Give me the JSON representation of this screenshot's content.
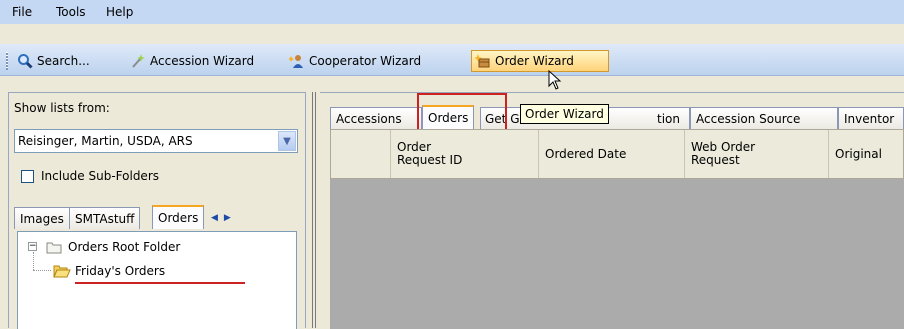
{
  "menu": {
    "items": [
      "File",
      "Tools",
      "Help"
    ]
  },
  "toolbar": {
    "search_label": "Search...",
    "accession_wizard_label": "Accession Wizard",
    "cooperator_wizard_label": "Cooperator Wizard",
    "order_wizard_label": "Order Wizard"
  },
  "left_panel": {
    "show_lists_label": "Show lists from:",
    "list_source_value": "Reisinger, Martin, USDA, ARS",
    "include_subfolders_label": "Include Sub-Folders",
    "include_subfolders_checked": false,
    "tabs": [
      "Images",
      "SMTAstuff",
      "Orders"
    ],
    "selected_tab": "Orders",
    "tree": {
      "root_label": "Orders Root Folder",
      "child_label": "Friday's Orders"
    }
  },
  "right_panel": {
    "tabs": [
      "Accessions",
      "Orders",
      "Get Ge",
      "tion",
      "Accession Source",
      "Inventor"
    ],
    "selected_tab": "Orders",
    "columns": [
      {
        "label": "Order\nRequest ID"
      },
      {
        "label": "Ordered Date"
      },
      {
        "label": "Web Order\nRequest"
      },
      {
        "label": "Original"
      }
    ]
  },
  "tooltip": {
    "text": "Order Wizard"
  },
  "colors": {
    "annotation_red": "#cc2222",
    "menubar": "#c4d8f4",
    "selected_tab_accent": "#f5a623"
  }
}
